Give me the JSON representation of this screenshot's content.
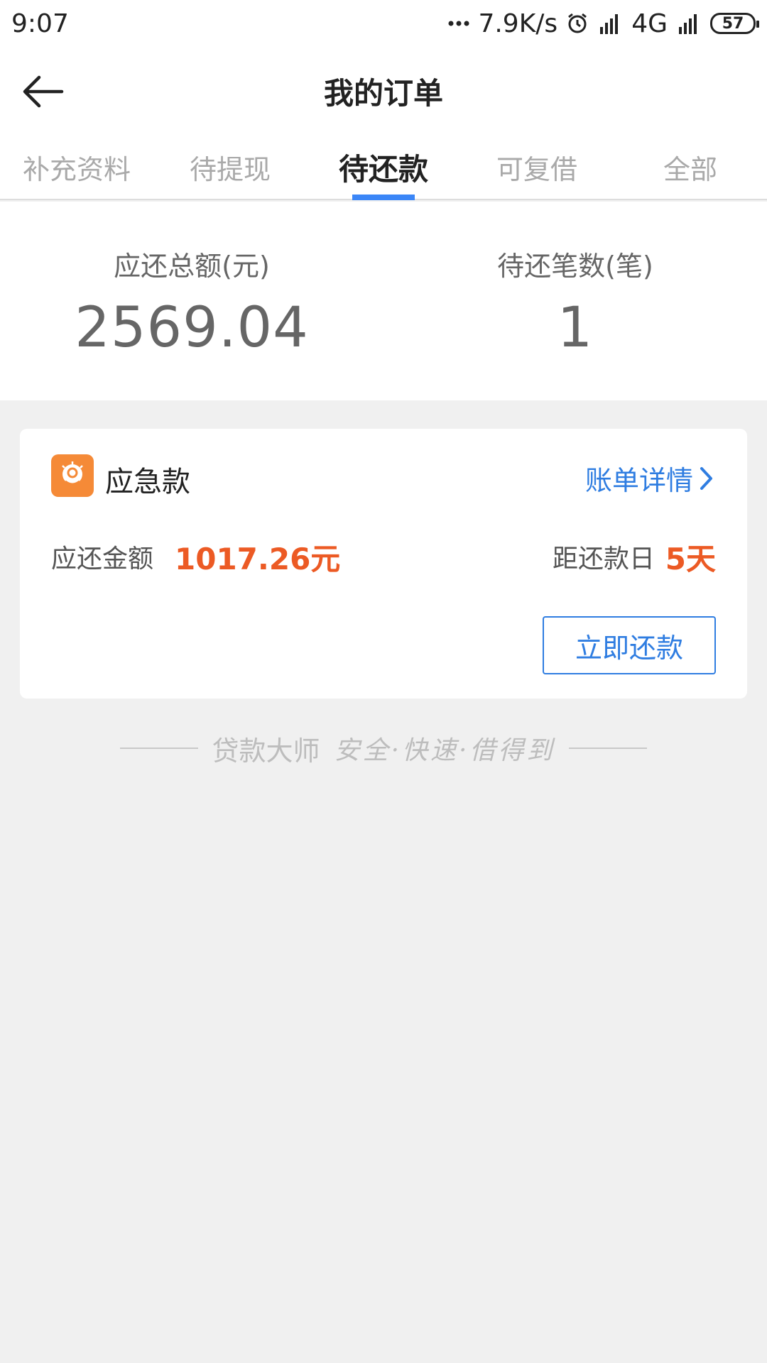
{
  "status_bar": {
    "time": "9:07",
    "speed": "7.9K/s",
    "network": "4G",
    "battery": "57"
  },
  "header": {
    "title": "我的订单"
  },
  "tabs": [
    {
      "label": "补充资料"
    },
    {
      "label": "待提现"
    },
    {
      "label": "待还款",
      "active": true
    },
    {
      "label": "可复借"
    },
    {
      "label": "全部"
    }
  ],
  "summary": {
    "total_label": "应还总额(元)",
    "total_value": "2569.04",
    "count_label": "待还笔数(笔)",
    "count_value": "1"
  },
  "order": {
    "icon": "app-logo-icon",
    "title": "应急款",
    "detail_link": "账单详情",
    "amount_label": "应还金额",
    "amount_value": "1017.26元",
    "due_label": "距还款日",
    "due_value": "5天",
    "repay_button": "立即还款"
  },
  "footer": {
    "brand": "贷款大师",
    "slogan": "安全·快速·借得到"
  },
  "colors": {
    "accent_blue": "#3b86f7",
    "link_blue": "#2f7de1",
    "highlight_orange": "#ec5a24",
    "logo_orange": "#f58a37",
    "background": "#f0f0f0"
  }
}
